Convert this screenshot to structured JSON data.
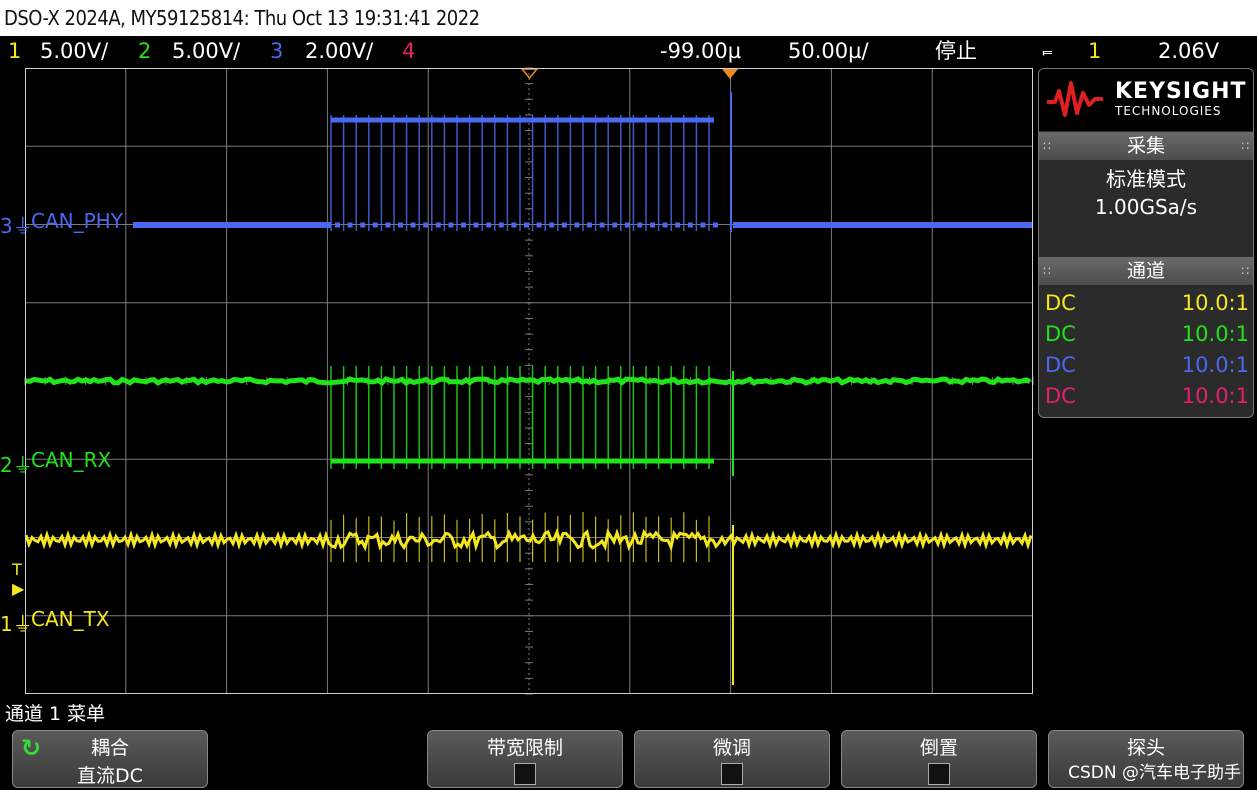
{
  "title_bar": "DSO-X 2024A, MY59125814: Thu Oct 13 19:31:41 2022",
  "status": {
    "ch1_num": "1",
    "ch1_scale": "5.00V/",
    "ch2_num": "2",
    "ch2_scale": "5.00V/",
    "ch3_num": "3",
    "ch3_scale": "2.00V/",
    "ch4_num": "4",
    "time_delay": "-99.00µ",
    "time_scale": "50.00µ/",
    "run_state": "停止",
    "trigger_icon": "trigger-edge-icon",
    "trigger_source": "1",
    "trigger_level": "2.06V"
  },
  "colors": {
    "ch1": "#f4e721",
    "ch2": "#22e21c",
    "ch3": "#4a68f0",
    "ch4": "#e5206a",
    "grid": "#7a7a7a"
  },
  "channel_labels": {
    "ch3": "CAN_PHY",
    "ch2": "CAN_RX",
    "ch1": "CAN_TX",
    "ch3_marker": "3",
    "ch2_marker": "2",
    "ch1_marker": "1",
    "trigger_marker": "T"
  },
  "side_panel": {
    "brand": "KEYSIGHT",
    "brand_sub": "TECHNOLOGIES",
    "acquire_header": "采集",
    "acquire_mode": "标准模式",
    "sample_rate": "1.00GSa/s",
    "channels_header": "通道",
    "channels": [
      {
        "coupling": "DC",
        "ratio": "10.0:1"
      },
      {
        "coupling": "DC",
        "ratio": "10.0:1"
      },
      {
        "coupling": "DC",
        "ratio": "10.0:1"
      },
      {
        "coupling": "DC",
        "ratio": "10.0:1"
      }
    ]
  },
  "menu": {
    "title": "通道 1 菜单",
    "softkeys": [
      {
        "title": "耦合",
        "value": "直流DC",
        "icon": "rotate-icon"
      },
      {
        "title": "带宽限制",
        "checked": false
      },
      {
        "title": "微调",
        "checked": false
      },
      {
        "title": "倒置",
        "checked": false
      },
      {
        "title": "探头"
      }
    ]
  },
  "watermark": "CSDN @汽车电子助手"
}
